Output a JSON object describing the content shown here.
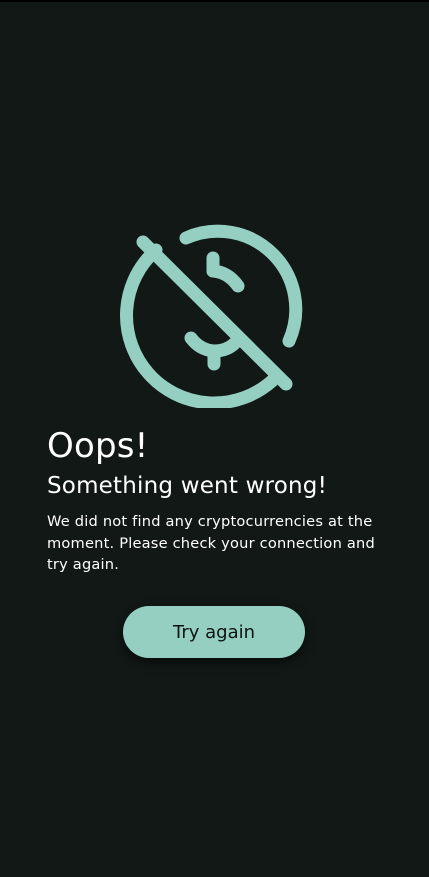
{
  "error": {
    "title": "Oops!",
    "subtitle": "Something went wrong!",
    "message": "We did not find any cryptocurrencies at the moment. Please check your connection and try again.",
    "icon": "no-money-icon"
  },
  "actions": {
    "retry_label": "Try again"
  },
  "colors": {
    "background": "#111816",
    "accent": "#95cfc1",
    "text": "#ffffff",
    "button_text": "#0d1311"
  }
}
